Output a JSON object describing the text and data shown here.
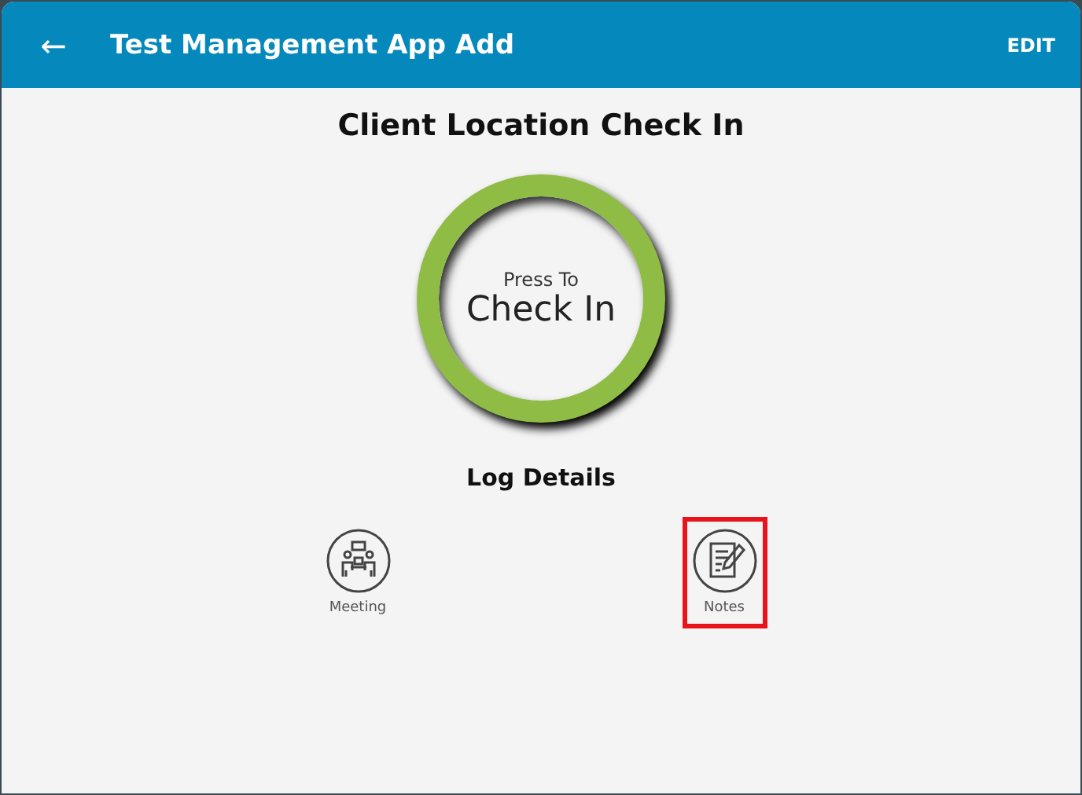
{
  "app_bar": {
    "back_icon": "←",
    "title": "Test Management App Add",
    "action": "EDIT"
  },
  "heading": "Client Location Check In",
  "check_in_button": {
    "caption": "Press To",
    "label": "Check In"
  },
  "section_title": "Log Details",
  "log_items": [
    {
      "kind": "meeting",
      "label": "Meeting",
      "highlighted": false
    },
    {
      "kind": "notes",
      "label": "Notes",
      "highlighted": true
    }
  ]
}
